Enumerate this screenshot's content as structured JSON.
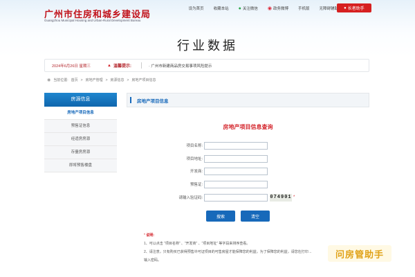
{
  "header": {
    "site_title": "广州市住房和城乡建设局",
    "site_subtitle": "Guangzhou Municipal Housing and Urban-Rural Development Bureau",
    "links": [
      {
        "label": "设为首页"
      },
      {
        "label": "收藏本站"
      },
      {
        "label": "关注微信"
      },
      {
        "label": "政务微博"
      },
      {
        "label": "手机版"
      },
      {
        "label": "无障碍辅助浏览"
      }
    ],
    "elder_button": "长者助手"
  },
  "banner": {
    "title": "行业数据"
  },
  "datebar": {
    "date": "2024年6月26日 星期三",
    "tip_label": "温馨提示:",
    "notice": "·  广州市新建商品房交易事项风险提示"
  },
  "breadcrumb": {
    "current_label": "当前位置:",
    "items": [
      "首页",
      "房地产管理",
      "房源信息",
      "房地产项目信息"
    ],
    "separator": ">"
  },
  "sidebar": {
    "title": "房源信息",
    "items": [
      {
        "label": "房地产项目信息",
        "active": true
      },
      {
        "label": "预售证信息"
      },
      {
        "label": "经适房房源"
      },
      {
        "label": "存量房房源"
      },
      {
        "label": "即将预售楼盘"
      }
    ]
  },
  "main": {
    "section_title": "房地产项目信息",
    "form_title": "房地产项目信息查询",
    "fields": [
      {
        "label": "项目名称:",
        "value": ""
      },
      {
        "label": "项目地址:",
        "value": ""
      },
      {
        "label": "开发商:",
        "value": ""
      },
      {
        "label": "预售证:",
        "value": ""
      },
      {
        "label": "请输入验证码:",
        "value": ""
      }
    ],
    "captcha": "074901",
    "required_mark": "*",
    "search_button": "搜索",
    "clear_button": "清空"
  },
  "notes": {
    "title_mark": "*",
    "title": "说明:",
    "lines": [
      "1、可以点击 “项目名称” 、“开发商” 、“项目地址” 等字段来排序查看。",
      "2、请注意，只有购买已获得预售许可证项目的可售房屋才能保障您的利益。为了保障您的利益，请您在打印…",
      "输入密码。"
    ]
  },
  "watermark": "问房管助手",
  "colors": {
    "brand_red": "#c1121a",
    "primary_blue": "#1769ba",
    "alert_red": "#d3232a"
  }
}
